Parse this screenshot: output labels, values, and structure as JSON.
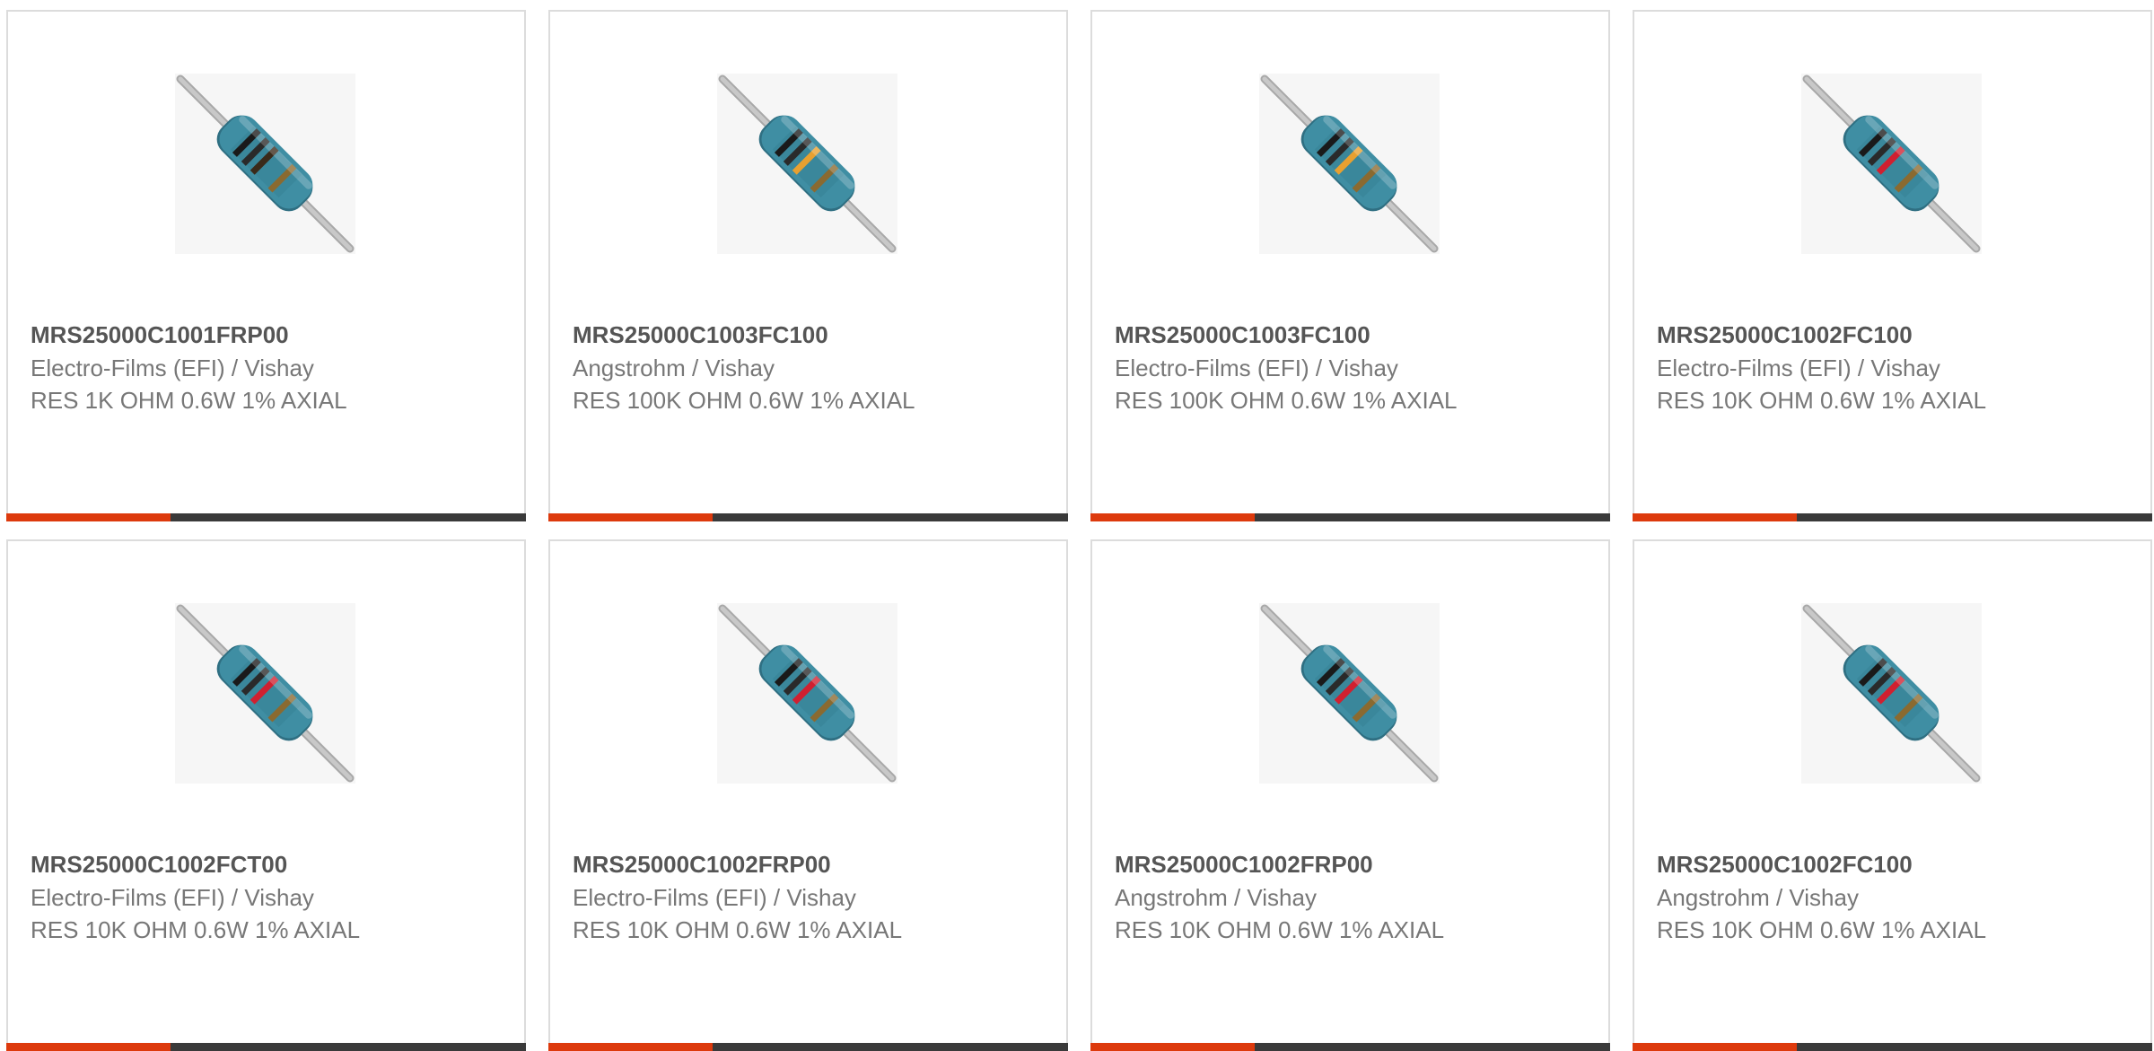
{
  "colors": {
    "accent": "#dd3a0d",
    "bar_dark": "#3a3a3a",
    "border": "#dcdcdc",
    "part_number_text": "#555555",
    "secondary_text": "#777777",
    "resistor_body": "#3f8ea3",
    "lead": "#c8c8c8"
  },
  "products": [
    {
      "part_number": "MRS25000C1001FRP00",
      "manufacturer": "Electro-Films (EFI) / Vishay",
      "description": "RES 1K OHM 0.6W 1% AXIAL",
      "image_icon": "resistor-icon",
      "band_colors": [
        "#1a1a1a",
        "#2a2a2a",
        "#3a2a1a",
        "#8a6a30"
      ]
    },
    {
      "part_number": "MRS25000C1003FC100",
      "manufacturer": "Angstrohm / Vishay",
      "description": "RES 100K OHM 0.6W 1% AXIAL",
      "image_icon": "resistor-icon",
      "band_colors": [
        "#1a1a1a",
        "#2a2a2a",
        "#e8a030",
        "#8a6a30"
      ]
    },
    {
      "part_number": "MRS25000C1003FC100",
      "manufacturer": "Electro-Films (EFI) / Vishay",
      "description": "RES 100K OHM 0.6W 1% AXIAL",
      "image_icon": "resistor-icon",
      "band_colors": [
        "#1a1a1a",
        "#2a2a2a",
        "#e8a030",
        "#8a6a30"
      ]
    },
    {
      "part_number": "MRS25000C1002FC100",
      "manufacturer": "Electro-Films (EFI) / Vishay",
      "description": "RES 10K OHM 0.6W 1% AXIAL",
      "image_icon": "resistor-icon",
      "band_colors": [
        "#1a1a1a",
        "#2a2a2a",
        "#d02030",
        "#8a6a30"
      ]
    },
    {
      "part_number": "MRS25000C1002FCT00",
      "manufacturer": "Electro-Films (EFI) / Vishay",
      "description": "RES 10K OHM 0.6W 1% AXIAL",
      "image_icon": "resistor-icon",
      "band_colors": [
        "#1a1a1a",
        "#2a2a2a",
        "#d02030",
        "#8a6a30"
      ]
    },
    {
      "part_number": "MRS25000C1002FRP00",
      "manufacturer": "Electro-Films (EFI) / Vishay",
      "description": "RES 10K OHM 0.6W 1% AXIAL",
      "image_icon": "resistor-icon",
      "band_colors": [
        "#1a1a1a",
        "#2a2a2a",
        "#d02030",
        "#8a6a30"
      ]
    },
    {
      "part_number": "MRS25000C1002FRP00",
      "manufacturer": "Angstrohm / Vishay",
      "description": "RES 10K OHM 0.6W 1% AXIAL",
      "image_icon": "resistor-icon",
      "band_colors": [
        "#1a1a1a",
        "#2a2a2a",
        "#d02030",
        "#8a6a30"
      ]
    },
    {
      "part_number": "MRS25000C1002FC100",
      "manufacturer": "Angstrohm / Vishay",
      "description": "RES 10K OHM 0.6W 1% AXIAL",
      "image_icon": "resistor-icon",
      "band_colors": [
        "#1a1a1a",
        "#2a2a2a",
        "#d02030",
        "#8a6a30"
      ]
    }
  ]
}
